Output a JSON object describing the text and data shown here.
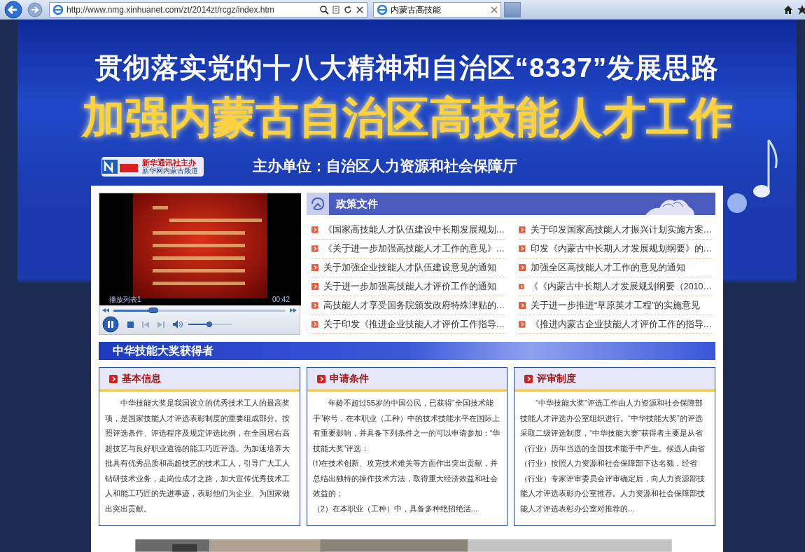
{
  "browser": {
    "url": "http://www.nmg.xinhuanet.com/zt/2014zt/rcgz/index.htm",
    "tabs": [
      {
        "title": "内蒙古高技能",
        "selected": true
      }
    ]
  },
  "banner": {
    "headline": "贯彻落实党的十八大精神和自治区“8337”发展思路",
    "title": "加强内蒙古自治区高技能人才工作",
    "logo_lines": [
      "新华通讯社主办",
      "新华网内蒙古频道"
    ],
    "sponsor": "主办单位：自治区人力资源和社会保障厅"
  },
  "video": {
    "playlist": "播放列表1",
    "time": "00:42",
    "progress": {
      "level": 0.23
    },
    "volume": {
      "level": 0.48
    },
    "playing": true
  },
  "policy": {
    "title": "政策文件",
    "columns": [
      [
        "《国家高技能人才队伍建设中长期发展规划…",
        "《关于进一步加强高技能人才工作的意见》…",
        "关于加强企业技能人才队伍建设意见的通知",
        "关于进一步加强高技能人才评价工作的通知",
        "高技能人才享受国务院颁发政府特殊津贴的…",
        "关于印发《推进企业技能人才评价工作指导…"
      ],
      [
        "关于印发国家高技能人才振兴计划实施方案…",
        "印发《内蒙古中长期人才发展规划纲要》的…",
        "加强全区高技能人才工作的意见的通知",
        "《《内蒙古中长期人才发展规划纲要（2010…",
        "关于进一步推进“草原英才工程”的实施意见",
        "《推进内蒙古企业技能人才评价工作的指导…"
      ]
    ]
  },
  "awards": {
    "title": "中华技能大奖获得者",
    "cards": [
      {
        "title": "基本信息",
        "paragraphs": [
          "中华技能大奖是我国设立的优秀技术工人的最高奖项，是国家技能人才评选表彰制度的重要组成部分。按照评选条件、评选程序及规定评选比例，在全国居右高超技艺与良好职业道德的能工巧匠评选。为加速培养大批具有优秀品质和高超技艺的技术工人，引导广大工人钻研技术业务，走岗位成才之路，加大宣传优秀技术工人和能工巧匠的先进事迹，表彰他们为企业、为国家做出突出贡献。"
        ]
      },
      {
        "title": "申请条件",
        "paragraphs": [
          "年龄不超过55岁的中国公民，已获得“全国技术能手”称号，在本职业（工种）中的技术技能水平在国际上有重要影响，并具备下列条件之一的可以申请参加：“华技能大奖”评选：",
          "⑴在技术创新、攻克技术难关等方面作出突出贡献，并总结出独特的操作技术方法，取得重大经济效益和社会效益的；",
          "（2）在本职业（工种）中，具备多种绝招绝活..."
        ]
      },
      {
        "title": "评审制度",
        "paragraphs": [
          "“中华技能大奖”评选工作由人力资源和社会保障部技能人才评选办公室组织进行。“中华技能大奖”的评选采取二级评选制度，“中华技能大赛”获得者主要是从省（行业）历年当选的全国技术能手中产生。候选人由省（行业）按照人力资源和社会保障部下达名额，经省（行业）专家评审委员会评审确定后，向人力资源部技能人才评选表彰办公室推荐。人力资源和社会保障部技能人才评选表彰办公室对推荐的..."
        ]
      }
    ]
  }
}
